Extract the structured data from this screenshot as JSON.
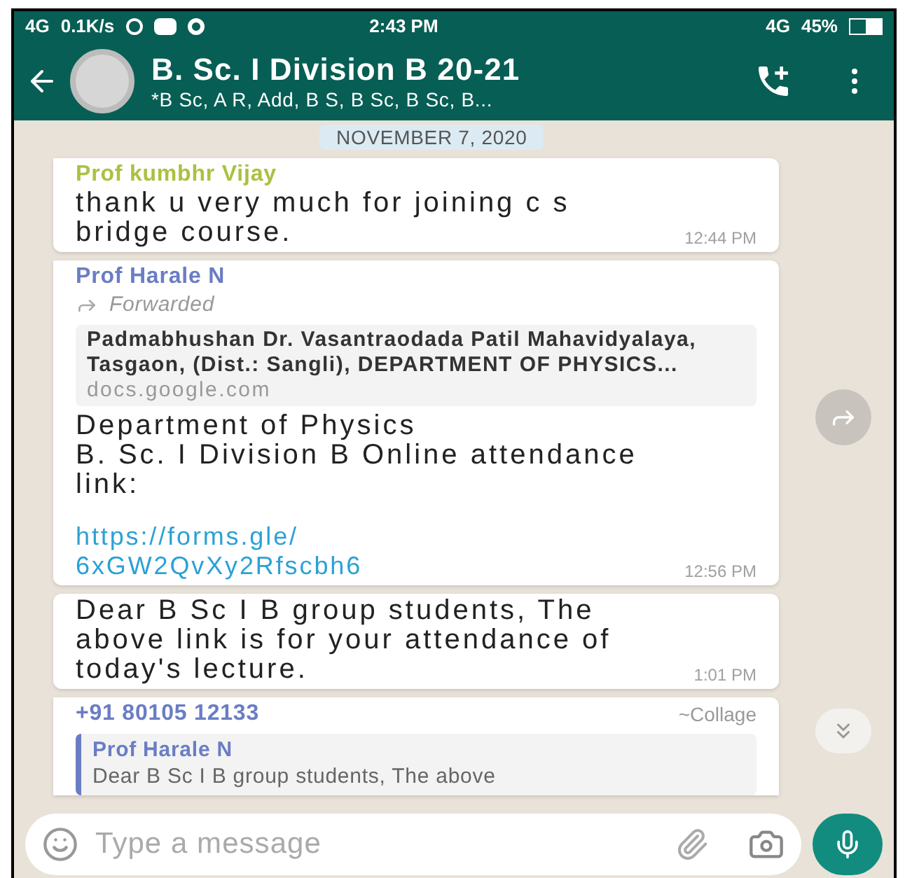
{
  "status_bar": {
    "network": "4G",
    "speed": "0.1K/s",
    "time": "2:43 PM",
    "network_right": "4G",
    "battery": "45%"
  },
  "header": {
    "title": "B. Sc. I Division B 20-21",
    "subtitle": "*B Sc, A R, Add, B S, B Sc, B Sc, B..."
  },
  "date_label": "NOVEMBER 7, 2020",
  "messages": [
    {
      "kind": "text",
      "sender": "Prof kumbhr Vijay",
      "color": "#a9c23f",
      "text": "thank u very much for joining c s bridge course.",
      "time": "12:44 PM"
    },
    {
      "kind": "forward",
      "sender": "Prof Harale N",
      "color": "#6a7dc4",
      "forwarded": "Forwarded",
      "preview": {
        "title": "Padmabhushan Dr. Vasantraodada Patil Mahavidyalaya, Tasgaon, (Dist.: Sangli), DEPARTMENT OF PHYSICS...",
        "domain": "docs.google.com"
      },
      "text": "Department of Physics\nB. Sc. I Division B Online attendance link:",
      "link": "https://forms.gle/\n6xGW2QvXy2Rfscbh6",
      "time": "12:56 PM"
    },
    {
      "kind": "text",
      "text": "Dear B Sc I B group students, The above link is for your attendance of today's lecture.",
      "time": "1:01 PM"
    },
    {
      "kind": "reply",
      "sender": "+91 80105 12133",
      "color": "#6a7dc4",
      "alias": "~Collage",
      "quote": {
        "sender": "Prof Harale N",
        "color": "#6a7dc4",
        "text": "Dear B Sc I B group students, The above"
      }
    }
  ],
  "composer": {
    "placeholder": "Type a message"
  }
}
